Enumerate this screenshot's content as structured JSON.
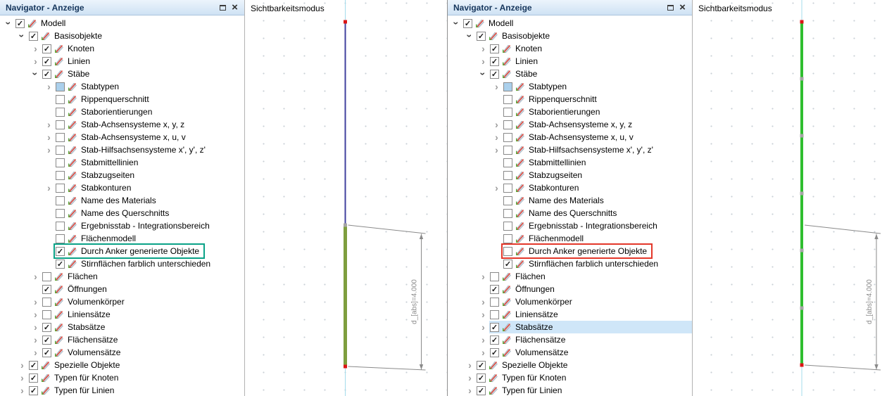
{
  "app": {
    "panel_title": "Navigator - Anzeige",
    "viewport_title": "Sichtbarkeitsmodus",
    "close_label": "×"
  },
  "colors": {
    "member_blue": "#40409e",
    "member_olive": "#7e9e3e",
    "member_green": "#2fbe2f",
    "node_red": "#dc1414",
    "marker_gray": "#a5a5a5",
    "guide_cyan": "#a5dcec",
    "dim_gray": "#8a8a8a",
    "highlight_teal": "#0aa287",
    "highlight_red": "#e3372a",
    "selection_blue": "#cfe6f8",
    "partial_blue": "#abd0ec"
  },
  "tree": [
    {
      "label": "Modell",
      "level": 0,
      "arrow": "expanded",
      "checked": true
    },
    {
      "label": "Basisobjekte",
      "level": 1,
      "arrow": "expanded",
      "checked": true
    },
    {
      "label": "Knoten",
      "level": 2,
      "arrow": "collapsed",
      "checked": true
    },
    {
      "label": "Linien",
      "level": 2,
      "arrow": "collapsed",
      "checked": true
    },
    {
      "label": "Stäbe",
      "level": 2,
      "arrow": "expanded",
      "checked": true
    },
    {
      "label": "Stabtypen",
      "level": 3,
      "arrow": "collapsed",
      "checked": "partial"
    },
    {
      "label": "Rippenquerschnitt",
      "level": 3,
      "arrow": null,
      "checked": false
    },
    {
      "label": "Staborientierungen",
      "level": 3,
      "arrow": null,
      "checked": false
    },
    {
      "label": "Stab-Achsensysteme x, y, z",
      "level": 3,
      "arrow": "collapsed",
      "checked": false
    },
    {
      "label": "Stab-Achsensysteme x, u, v",
      "level": 3,
      "arrow": "collapsed",
      "checked": false
    },
    {
      "label": "Stab-Hilfsachsensysteme x', y', z'",
      "level": 3,
      "arrow": "collapsed",
      "checked": false
    },
    {
      "label": "Stabmittellinien",
      "level": 3,
      "arrow": null,
      "checked": false
    },
    {
      "label": "Stabzugseiten",
      "level": 3,
      "arrow": null,
      "checked": false
    },
    {
      "label": "Stabkonturen",
      "level": 3,
      "arrow": "collapsed",
      "checked": false
    },
    {
      "label": "Name des Materials",
      "level": 3,
      "arrow": null,
      "checked": false
    },
    {
      "label": "Name des Querschnitts",
      "level": 3,
      "arrow": null,
      "checked": false
    },
    {
      "label": "Ergebnisstab - Integrationsbereich",
      "level": 3,
      "arrow": null,
      "checked": false
    },
    {
      "label": "Flächenmodell",
      "level": 3,
      "arrow": null,
      "checked": false
    },
    {
      "label": "Durch Anker generierte Objekte",
      "level": 3,
      "arrow": null,
      "checked": false
    },
    {
      "label": "Stirnflächen farblich unterschieden",
      "level": 3,
      "arrow": null,
      "checked": true
    },
    {
      "label": "Flächen",
      "level": 2,
      "arrow": "collapsed",
      "checked": false
    },
    {
      "label": "Öffnungen",
      "level": 2,
      "arrow": null,
      "checked": true
    },
    {
      "label": "Volumenkörper",
      "level": 2,
      "arrow": "collapsed",
      "checked": false
    },
    {
      "label": "Liniensätze",
      "level": 2,
      "arrow": "collapsed",
      "checked": false
    },
    {
      "label": "Stabsätze",
      "level": 2,
      "arrow": "collapsed",
      "checked": true
    },
    {
      "label": "Flächensätze",
      "level": 2,
      "arrow": "collapsed",
      "checked": true
    },
    {
      "label": "Volumensätze",
      "level": 2,
      "arrow": "collapsed",
      "checked": true
    },
    {
      "label": "Spezielle Objekte",
      "level": 1,
      "arrow": "collapsed",
      "checked": true
    },
    {
      "label": "Typen für Knoten",
      "level": 1,
      "arrow": "collapsed",
      "checked": true
    },
    {
      "label": "Typen für Linien",
      "level": 1,
      "arrow": "collapsed",
      "checked": true
    }
  ],
  "panels": [
    {
      "name": "left",
      "dimension_label": "d_[abs]=4.000",
      "overrides": {
        "18": {
          "checked": true,
          "highlight": "teal"
        }
      }
    },
    {
      "name": "right",
      "dimension_label": "d_[abs]=4.000",
      "overrides": {
        "18": {
          "checked": false,
          "highlight": "red"
        },
        "24": {
          "selected": true
        }
      }
    }
  ]
}
